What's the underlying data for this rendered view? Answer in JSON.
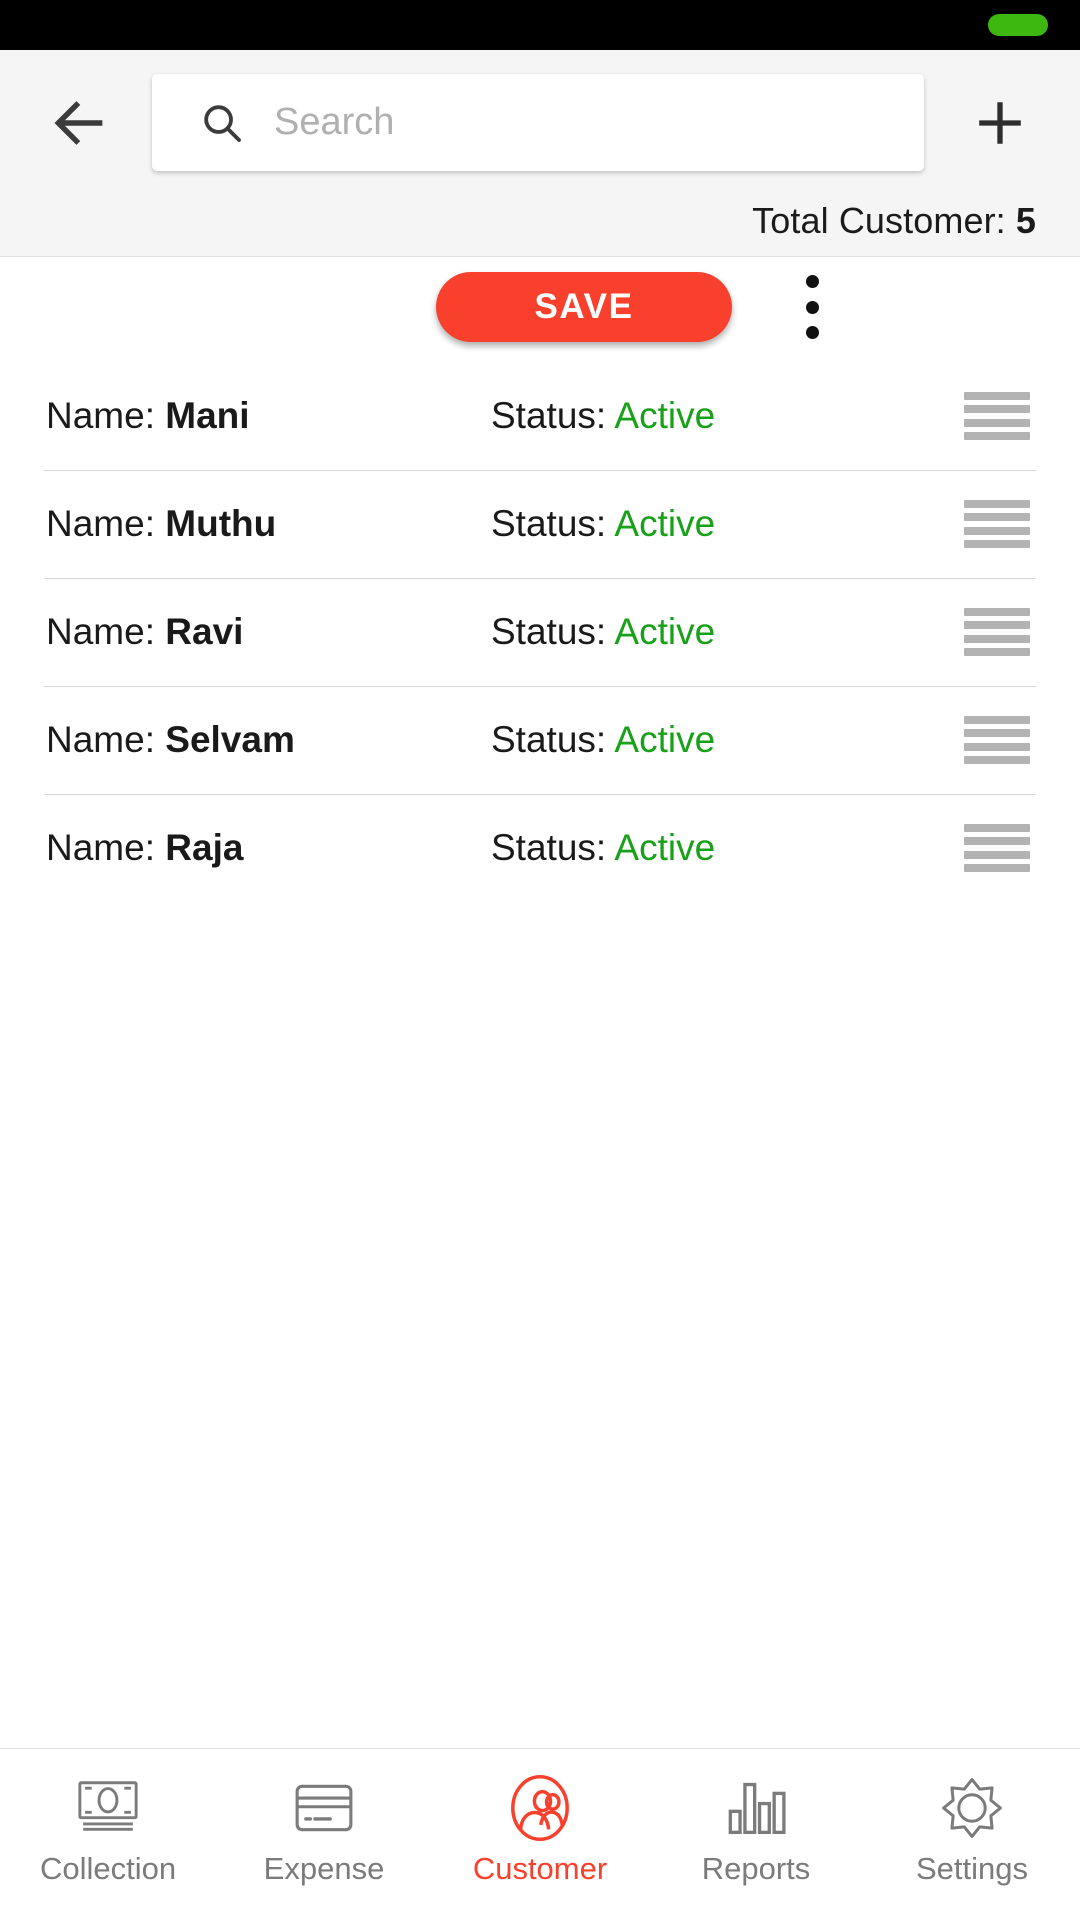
{
  "status_bar": {
    "indicator_color": "#3cb811",
    "indicator_name": "battery-pill"
  },
  "header": {
    "back_icon": "arrow-left-icon",
    "add_icon": "plus-icon",
    "search": {
      "placeholder": "Search",
      "value": "",
      "icon": "search-icon"
    },
    "total_label": "Total Customer: ",
    "total_count": "5"
  },
  "action_bar": {
    "save_label": "SAVE",
    "save_color": "#f9402c",
    "overflow_icon": "kebab-menu-icon"
  },
  "list": {
    "name_prefix": "Name: ",
    "status_prefix": "Status: ",
    "status_color": "#18a018",
    "handle_icon": "drag-handle-icon",
    "rows": [
      {
        "name": "Mani",
        "status": "Active"
      },
      {
        "name": "Muthu",
        "status": "Active"
      },
      {
        "name": "Ravi",
        "status": "Active"
      },
      {
        "name": "Selvam",
        "status": "Active"
      },
      {
        "name": "Raja",
        "status": "Active"
      }
    ]
  },
  "bottom_nav": {
    "active_color": "#f9402c",
    "inactive_color": "#7b7b7b",
    "items": [
      {
        "label": "Collection",
        "icon": "banknote-icon",
        "active": false
      },
      {
        "label": "Expense",
        "icon": "credit-card-icon",
        "active": false
      },
      {
        "label": "Customer",
        "icon": "users-circle-icon",
        "active": true
      },
      {
        "label": "Reports",
        "icon": "bar-chart-icon",
        "active": false
      },
      {
        "label": "Settings",
        "icon": "gear-icon",
        "active": false
      }
    ]
  }
}
